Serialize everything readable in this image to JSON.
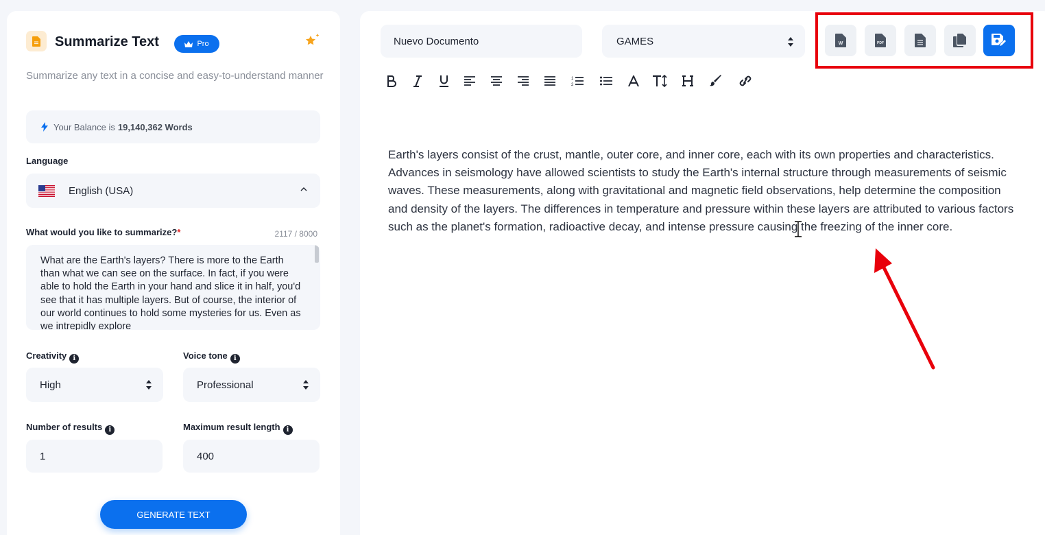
{
  "tool": {
    "title": "Summarize Text",
    "badge": "Pro",
    "description": "Summarize any text in a concise and easy-to-understand manner"
  },
  "balance": {
    "prefix": "Your Balance is",
    "amount": "19,140,362 Words"
  },
  "language": {
    "label": "Language",
    "selected": "English (USA)"
  },
  "input": {
    "label": "What would you like to summarize?",
    "required_mark": "*",
    "counter": "2117 / 8000",
    "value": "What are the Earth's layers?   There is more to the Earth than what we can see on the surface. In fact, if you were able to hold the Earth in your hand and slice it in half, you'd see that it has multiple layers. But of course, the interior of our world continues to hold some mysteries for us. Even as we intrepidly explore"
  },
  "creativity": {
    "label": "Creativity",
    "selected": "High"
  },
  "voice_tone": {
    "label": "Voice tone",
    "selected": "Professional"
  },
  "num_results": {
    "label": "Number of results",
    "value": "1"
  },
  "max_length": {
    "label": "Maximum result length",
    "value": "400"
  },
  "generate_button": "GENERATE TEXT",
  "document": {
    "name": "Nuevo Documento",
    "category": "GAMES",
    "export_buttons": [
      "word-export-icon",
      "pdf-export-icon",
      "txt-export-icon",
      "copy-icon",
      "save-document-icon"
    ],
    "content": "Earth's layers consist of the crust, mantle, outer core, and inner core, each with its own properties and characteristics. Advances in seismology have allowed scientists to study the Earth's internal structure through measurements of seismic waves. These measurements, along with gravitational and magnetic field observations, help determine the composition and density of the layers. The differences in temperature and pressure within these layers are attributed to various factors such as the planet's formation, radioactive decay, and intense pressure causing the freezing of the inner core."
  },
  "toolbar_icons": [
    "bold-icon",
    "italic-icon",
    "underline-icon",
    "align-left-icon",
    "align-center-icon",
    "align-right-icon",
    "align-justify-icon",
    "ordered-list-icon",
    "bullet-list-icon",
    "font-color-icon",
    "font-size-icon",
    "heading-icon",
    "brush-icon",
    "link-icon"
  ],
  "colors": {
    "accent": "#0b70ee",
    "annotation_red": "#e8000b",
    "field_bg": "#f4f6fa"
  }
}
